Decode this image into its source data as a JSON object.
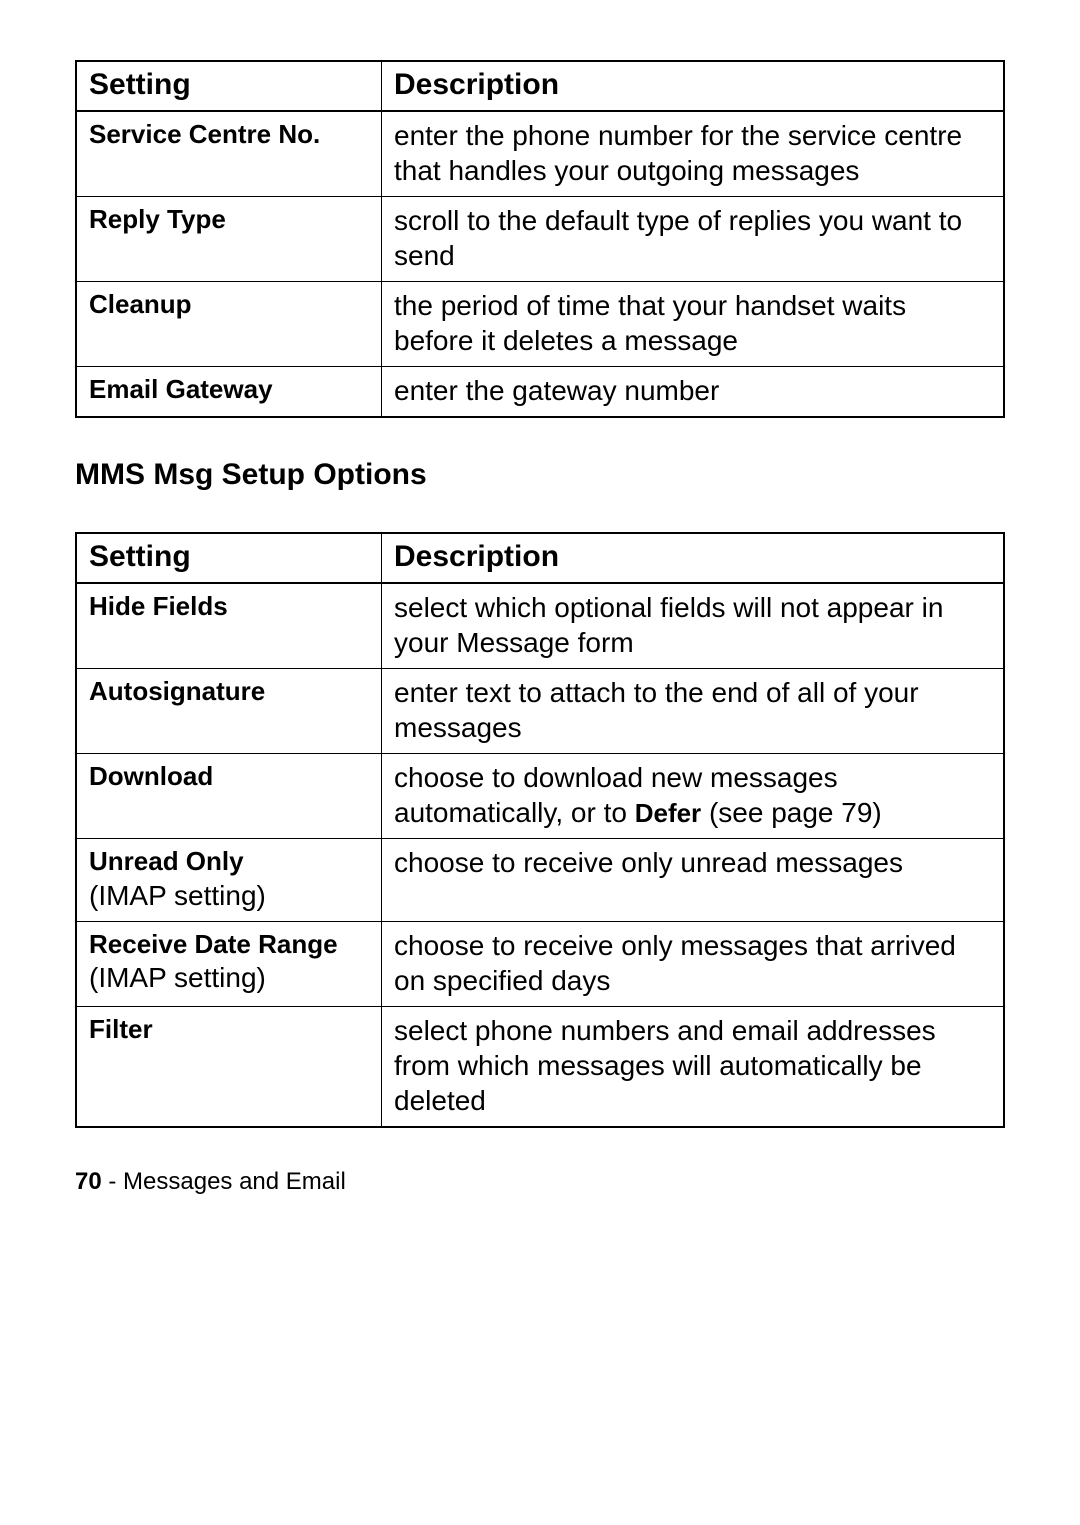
{
  "table1": {
    "headers": {
      "setting": "Setting",
      "description": "Description"
    },
    "rows": [
      {
        "name": "Service Centre No.",
        "sub": "",
        "desc": "enter the phone number for the service centre that handles your outgoing messages"
      },
      {
        "name": "Reply Type",
        "sub": "",
        "desc": "scroll to the default type of replies you want to send"
      },
      {
        "name": "Cleanup",
        "sub": "",
        "desc": "the period of time that your handset waits before it deletes a message"
      },
      {
        "name": "Email Gateway",
        "sub": "",
        "desc": "enter the gateway number"
      }
    ]
  },
  "section_heading": "MMS Msg Setup Options",
  "table2": {
    "headers": {
      "setting": "Setting",
      "description": "Description"
    },
    "rows": [
      {
        "name": "Hide Fields",
        "sub": "",
        "desc_pre": "select which optional fields will not appear in your Message form",
        "defer": "",
        "desc_post": ""
      },
      {
        "name": "Autosignature",
        "sub": "",
        "desc_pre": "enter text to attach to the end of all of your messages",
        "defer": "",
        "desc_post": ""
      },
      {
        "name": "Download",
        "sub": "",
        "desc_pre": "choose to download new messages automatically, or to ",
        "defer": "Defer",
        "desc_post": " (see page 79)"
      },
      {
        "name": "Unread Only",
        "sub": "(IMAP setting)",
        "desc_pre": "choose to receive only unread messages",
        "defer": "",
        "desc_post": ""
      },
      {
        "name": "Receive Date Range",
        "sub": "(IMAP setting)",
        "desc_pre": "choose to receive only messages that arrived on specified days",
        "defer": "",
        "desc_post": ""
      },
      {
        "name": "Filter",
        "sub": "",
        "desc_pre": "select phone numbers and email addresses from which messages will automatically be deleted",
        "defer": "",
        "desc_post": ""
      }
    ]
  },
  "footer": {
    "page": "70",
    "sep": " - ",
    "section": "Messages and Email"
  }
}
